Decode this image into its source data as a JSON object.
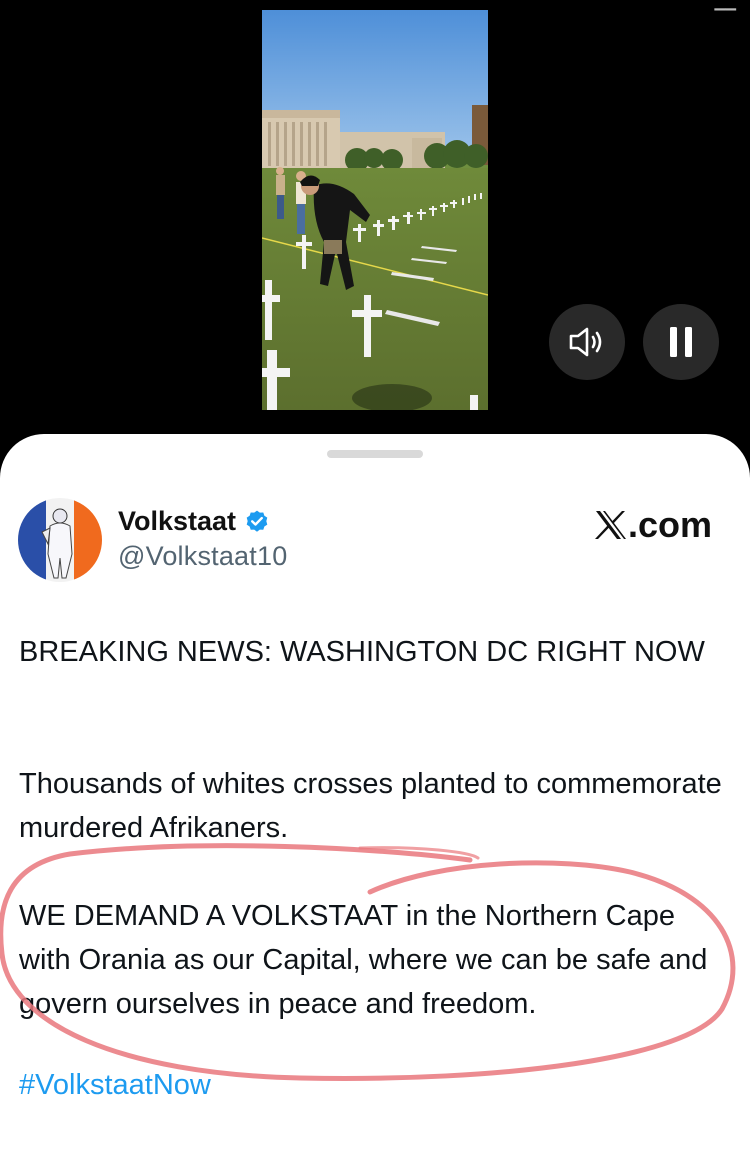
{
  "video": {
    "sound_icon": "speaker-icon",
    "pause_icon": "pause-icon"
  },
  "post": {
    "display_name": "Volkstaat",
    "verified_icon": "verified-badge-icon",
    "handle": "@Volkstaat10",
    "brand_text": ".com",
    "brand_logo": "x-logo-icon",
    "paragraphs": [
      "BREAKING NEWS: WASHINGTON DC RIGHT NOW",
      "Thousands of whites crosses planted to commemorate murdered Afrikaners.",
      "WE DEMAND A VOLKSTAAT in the Northern Cape with Orania as our Capital, where we can be safe and govern ourselves in peace and freedom."
    ],
    "hashtag": "#VolkstaatNow"
  },
  "colors": {
    "sheet_bg": "#ffffff",
    "text": "#0f1419",
    "secondary_text": "#536471",
    "link": "#1d9bf0",
    "verified": "#1d9bf0",
    "annotation": "#e9777c"
  }
}
